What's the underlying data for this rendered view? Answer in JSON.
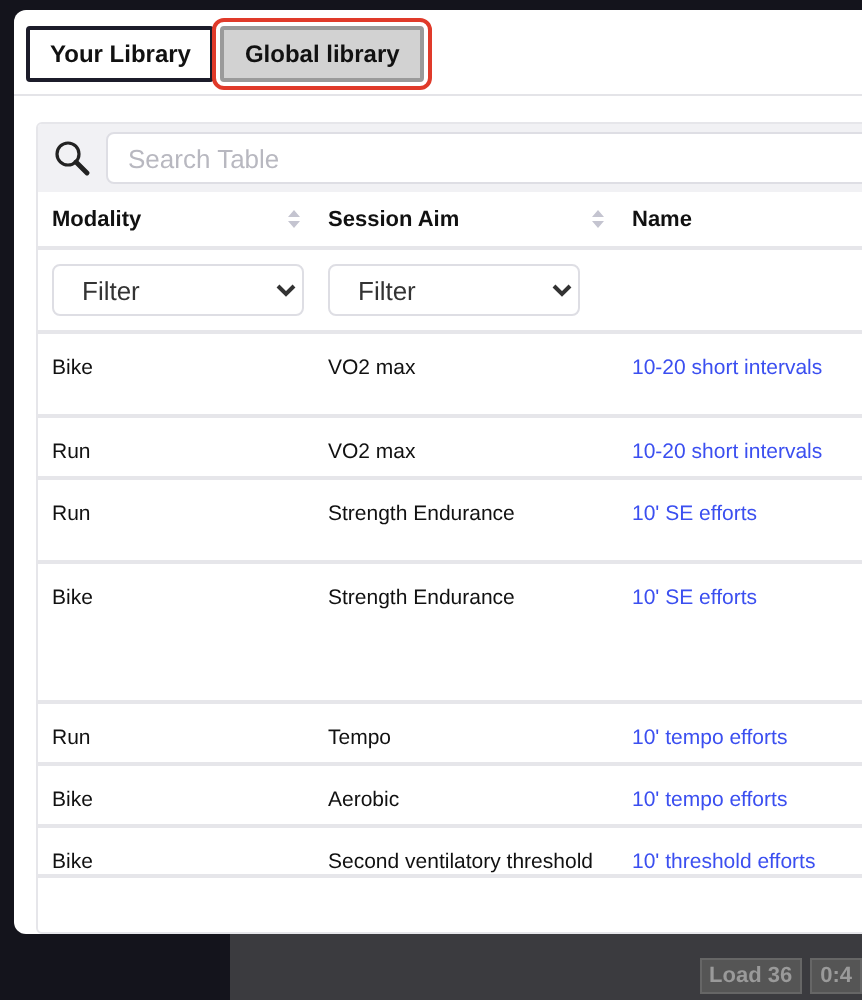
{
  "background": {
    "badges": [
      "Load 36",
      "0:4"
    ]
  },
  "tabs": [
    {
      "label": "Your Library",
      "selected": false,
      "highlighted": false
    },
    {
      "label": "Global library",
      "selected": true,
      "highlighted": true
    }
  ],
  "search": {
    "placeholder": "Search Table"
  },
  "table": {
    "columns": [
      {
        "label": "Modality",
        "filter": "Filter"
      },
      {
        "label": "Session Aim",
        "filter": "Filter"
      },
      {
        "label": "Name"
      }
    ],
    "rows": [
      {
        "modality": "Bike",
        "aim": "VO2 max",
        "name": "10-20 short intervals"
      },
      {
        "modality": "Run",
        "aim": "VO2 max",
        "name": "10-20 short intervals"
      },
      {
        "modality": "Run",
        "aim": "Strength Endurance",
        "name": "10' SE efforts"
      },
      {
        "modality": "Bike",
        "aim": "Strength Endurance",
        "name": "10' SE efforts"
      },
      {
        "modality": "Run",
        "aim": "Tempo",
        "name": "10' tempo efforts"
      },
      {
        "modality": "Bike",
        "aim": "Aerobic",
        "name": "10' tempo efforts"
      },
      {
        "modality": "Bike",
        "aim": "Second ventilatory threshold",
        "name": "10' threshold efforts"
      }
    ]
  }
}
